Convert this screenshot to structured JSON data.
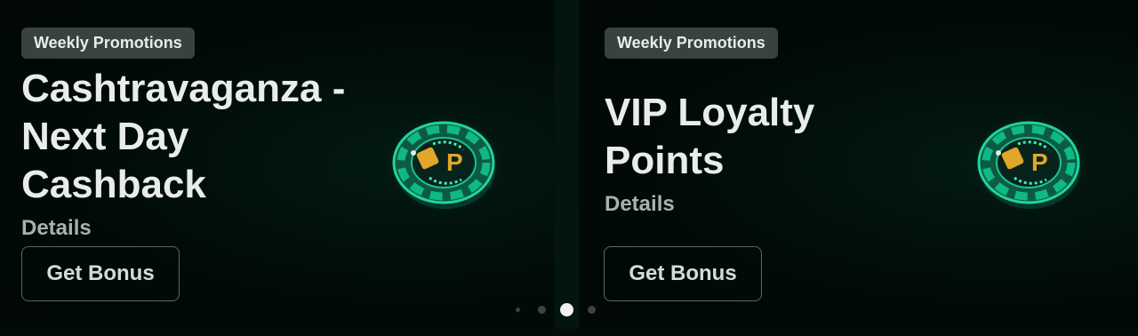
{
  "promotions": [
    {
      "badge": "Weekly Promotions",
      "title": "Cashtravaganza - Next Day Cashback",
      "details_label": "Details",
      "button_label": "Get Bonus",
      "icon": "casino-chip-icon"
    },
    {
      "badge": "Weekly Promotions",
      "title": "VIP Loyalty Points",
      "details_label": "Details",
      "button_label": "Get Bonus",
      "icon": "casino-chip-icon"
    }
  ],
  "pagination": {
    "total": 4,
    "active_index": 2
  },
  "colors": {
    "background": "#020d09",
    "badge_bg": "#3a423f",
    "accent_green": "#1fd49a",
    "coin_gold": "#e0a72a"
  }
}
